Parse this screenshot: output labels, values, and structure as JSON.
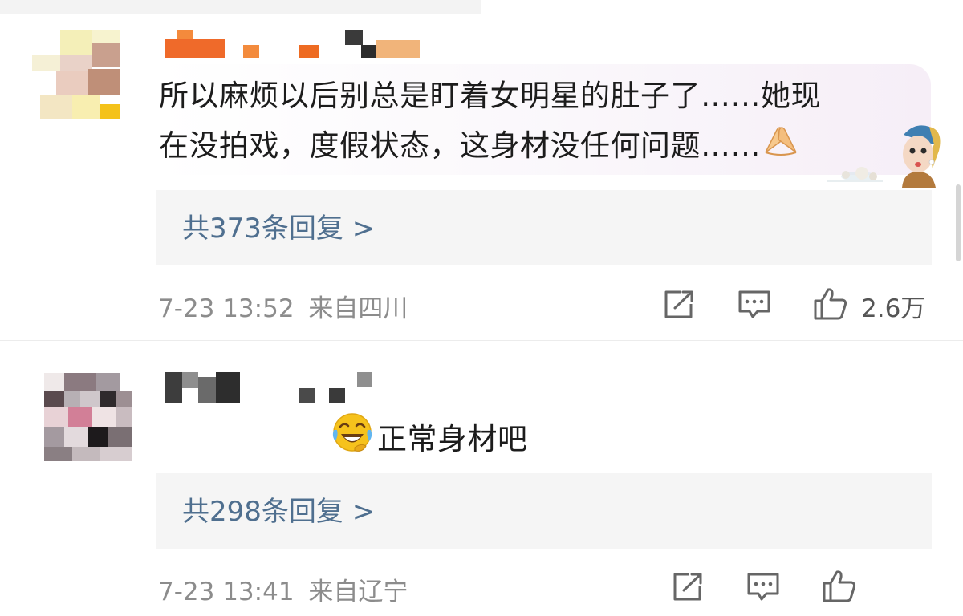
{
  "comments": [
    {
      "text_line1": "所以麻烦以后别总是盯着女明星的肚子了……她现",
      "text_line2": "在没拍戏，度假状态，这身材没任何问题……",
      "replies_label": "共373条回复 >",
      "date": "7-23 13:52",
      "location": "来自四川",
      "like_count": "2.6万",
      "inline_emoji": "clasping-hands-icon",
      "sticker": "girl-with-pearl-earring-sticker"
    },
    {
      "text": "正常身材吧",
      "inline_emoji": "laughing-crying-icon",
      "replies_label": "共298条回复 >",
      "date": "7-23 13:41",
      "location": "来自辽宁",
      "like_count": ""
    }
  ],
  "icons": {
    "share": "share-icon",
    "reply": "comment-icon",
    "like": "thumbs-up-icon"
  },
  "colors": {
    "link": "#4f6f8f",
    "meta": "#8c8c8c",
    "reply_bg": "#f5f5f5"
  }
}
